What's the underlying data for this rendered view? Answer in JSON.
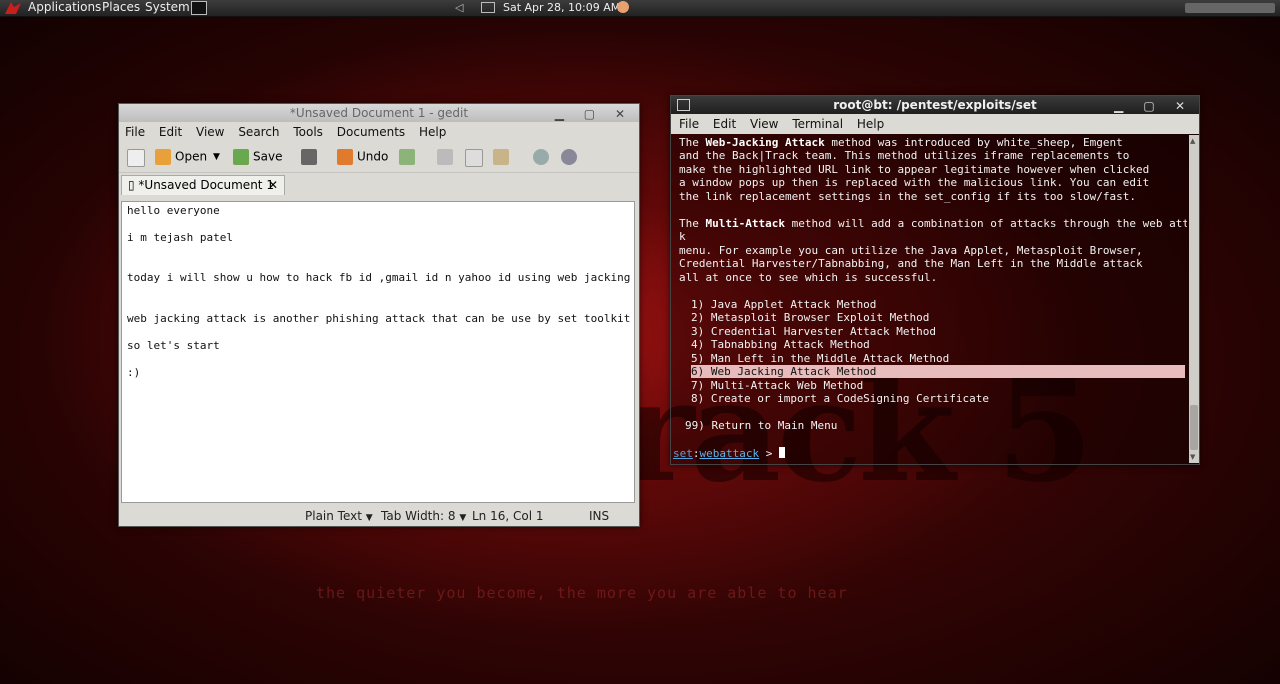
{
  "panel": {
    "applications": "Applications",
    "places": "Places",
    "system": "System",
    "clock": "Sat Apr 28, 10:09 AM"
  },
  "wallpaper": {
    "logo": "track 5",
    "tagline": "the quieter you become, the more you are able to hear"
  },
  "gedit": {
    "title": "*Unsaved Document 1 - gedit",
    "menu": [
      "File",
      "Edit",
      "View",
      "Search",
      "Tools",
      "Documents",
      "Help"
    ],
    "toolbar": {
      "open": "Open",
      "save": "Save",
      "undo": "Undo"
    },
    "tab_label": "*Unsaved Document 1",
    "lines": [
      "hello everyone",
      "i m tejash patel",
      "today i will show u how to hack fb id ,gmail id n yahoo id using web jacking",
      "web jacking attack is another phishing attack that can be use by set toolkit",
      "so let's start",
      ":)"
    ],
    "status": {
      "language": "Plain Text",
      "tab_width": "Tab Width:  8",
      "position": "Ln 16, Col 1",
      "mode": "INS"
    }
  },
  "terminal": {
    "title": "root@bt: /pentest/exploits/set",
    "menu": [
      "File",
      "Edit",
      "View",
      "Terminal",
      "Help"
    ],
    "p1": {
      "pre": "The ",
      "bold": "Web-Jacking Attack",
      "rest": " method was introduced by white_sheep, Emgent",
      "lines": [
        "and the Back|Track team. This method utilizes iframe replacements to",
        "make the highlighted URL link to appear legitimate however when clicked",
        "a window pops up then is replaced with the malicious link. You can edit",
        "the link replacement settings in the set_config if its too slow/fast."
      ]
    },
    "p2": {
      "pre": "The ",
      "bold": "Multi-Attack",
      "rest": " method will add a combination of attacks through the web attac",
      "lines": [
        "k",
        "menu. For example you can utilize the Java Applet, Metasploit Browser,",
        "Credential Harvester/Tabnabbing, and the Man Left in the Middle attack",
        "all at once to see which is successful."
      ]
    },
    "options": [
      "1) Java Applet Attack Method",
      "2) Metasploit Browser Exploit Method",
      "3) Credential Harvester Attack Method",
      "4) Tabnabbing Attack Method",
      "5) Man Left in the Middle Attack Method",
      "6) Web Jacking Attack Method",
      "7) Multi-Attack Web Method",
      "8) Create or import a CodeSigning Certificate"
    ],
    "return_option": "99) Return to Main Menu",
    "prompt": {
      "set": "set",
      "colon": ":",
      "module": "webattack",
      "arrow": " >"
    }
  }
}
